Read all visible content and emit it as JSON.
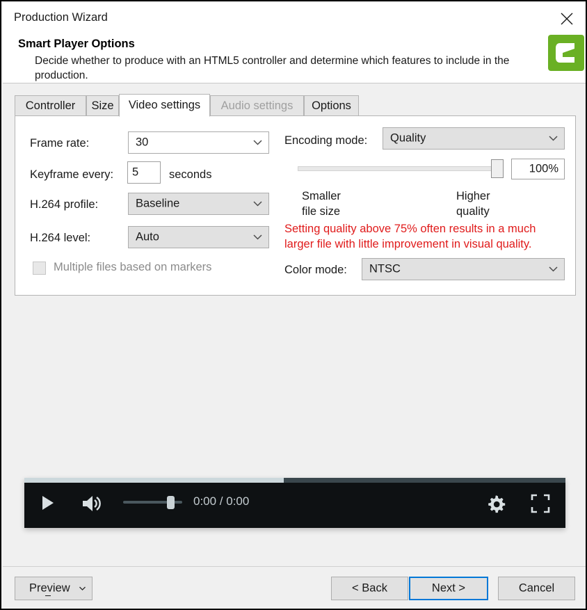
{
  "window": {
    "title": "Production Wizard",
    "close_icon": "close-icon"
  },
  "header": {
    "title": "Smart Player Options",
    "description": "Decide whether to produce with an HTML5 controller and determine which features to include in the production.",
    "logo_icon": "camtasia-logo-icon",
    "logo_color": "#6ab024"
  },
  "tabs": [
    {
      "label": "Controller",
      "selected": false,
      "disabled": false
    },
    {
      "label": "Size",
      "selected": false,
      "disabled": false
    },
    {
      "label": "Video settings",
      "selected": true,
      "disabled": false
    },
    {
      "label": "Audio settings",
      "selected": false,
      "disabled": true
    },
    {
      "label": "Options",
      "selected": false,
      "disabled": false
    }
  ],
  "video_settings": {
    "frame_rate": {
      "label": "Frame rate:",
      "value": "30"
    },
    "keyframe": {
      "label": "Keyframe every:",
      "value": "5",
      "unit": "seconds"
    },
    "h264_profile": {
      "label": "H.264 profile:",
      "value": "Baseline"
    },
    "h264_level": {
      "label": "H.264 level:",
      "value": "Auto"
    },
    "multiple_files": {
      "label": "Multiple files based on markers",
      "checked": false,
      "disabled": true
    },
    "encoding_mode": {
      "label": "Encoding mode:",
      "value": "Quality"
    },
    "quality": {
      "value": "100%",
      "percent": 100,
      "left_line1": "Smaller",
      "left_line2": "file size",
      "right_line1": "Higher",
      "right_line2": "quality"
    },
    "warning": {
      "line1": "Setting quality above 75% often results in a much",
      "line2": "larger file with little improvement in visual quality.",
      "color": "#e01b1b"
    },
    "color_mode": {
      "label": "Color mode:",
      "value": "NTSC"
    }
  },
  "player": {
    "play_icon": "play-icon",
    "volume_icon": "volume-icon",
    "settings_icon": "gear-icon",
    "fullscreen_icon": "fullscreen-icon",
    "time": "0:00 / 0:00",
    "buffer_percent": 48,
    "volume_percent": 80
  },
  "footer": {
    "preview": {
      "label": "Preview",
      "dropdown_icon": "chevron-down-icon"
    },
    "back": {
      "label": "< Back"
    },
    "next": {
      "label": "Next >",
      "is_default": true
    },
    "cancel": {
      "label": "Cancel"
    }
  }
}
